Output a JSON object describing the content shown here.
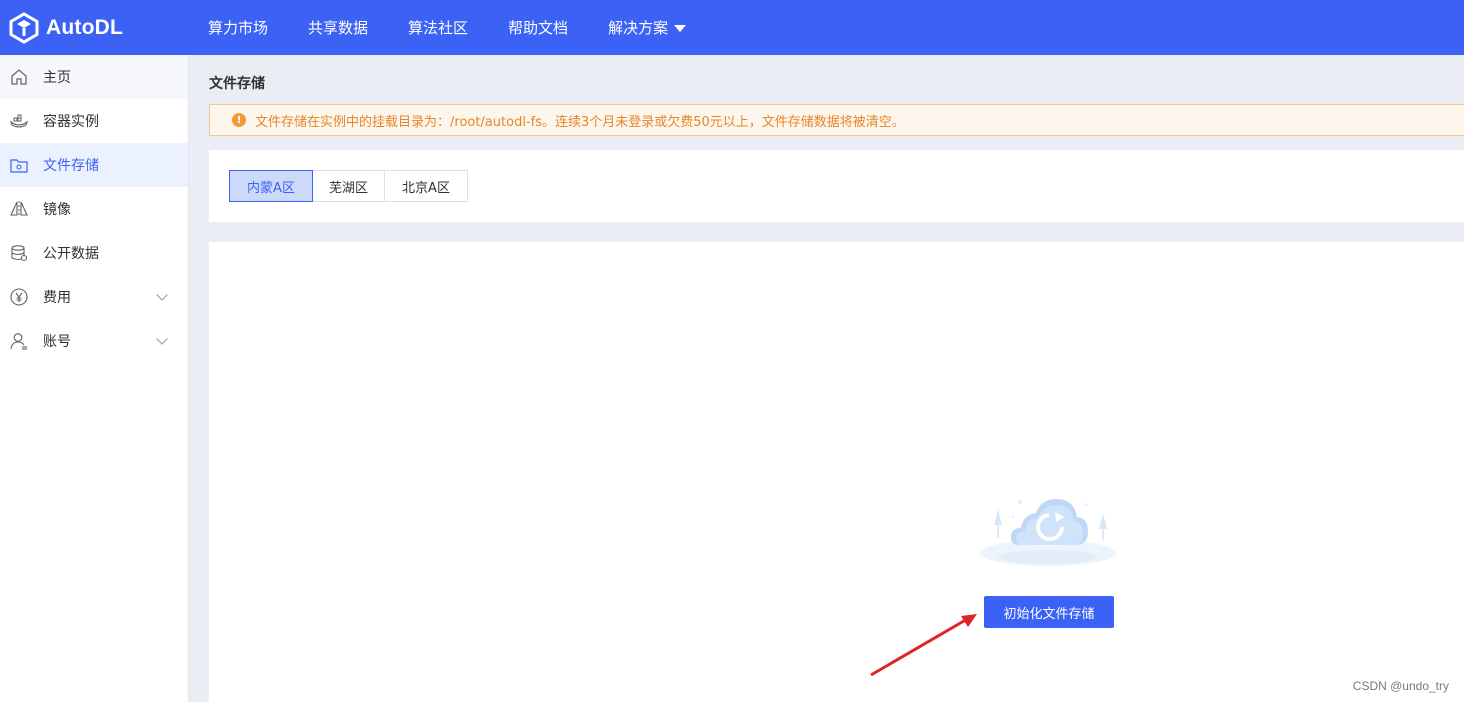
{
  "header": {
    "logo_text": "AutoDL",
    "nav": [
      {
        "label": "算力市场"
      },
      {
        "label": "共享数据"
      },
      {
        "label": "算法社区"
      },
      {
        "label": "帮助文档"
      },
      {
        "label": "解决方案",
        "has_dropdown": true
      }
    ],
    "colors": {
      "bar": "#3c62f5"
    }
  },
  "sidebar": {
    "items": [
      {
        "label": "主页",
        "icon": "home-icon"
      },
      {
        "label": "容器实例",
        "icon": "container-icon"
      },
      {
        "label": "文件存储",
        "icon": "storage-icon",
        "active": true
      },
      {
        "label": "镜像",
        "icon": "mirror-icon"
      },
      {
        "label": "公开数据",
        "icon": "database-icon"
      },
      {
        "label": "费用",
        "icon": "yen-icon",
        "expandable": true
      },
      {
        "label": "账号",
        "icon": "user-icon",
        "expandable": true
      }
    ]
  },
  "main": {
    "title": "文件存储",
    "alert": "文件存储在实例中的挂载目录为：/root/autodl-fs。连续3个月未登录或欠费50元以上，文件存储数据将被清空。",
    "regions": [
      {
        "label": "内蒙A区",
        "active": true
      },
      {
        "label": "芜湖区"
      },
      {
        "label": "北京A区"
      }
    ],
    "init_button": "初始化文件存储"
  },
  "watermark": "CSDN @undo_try"
}
